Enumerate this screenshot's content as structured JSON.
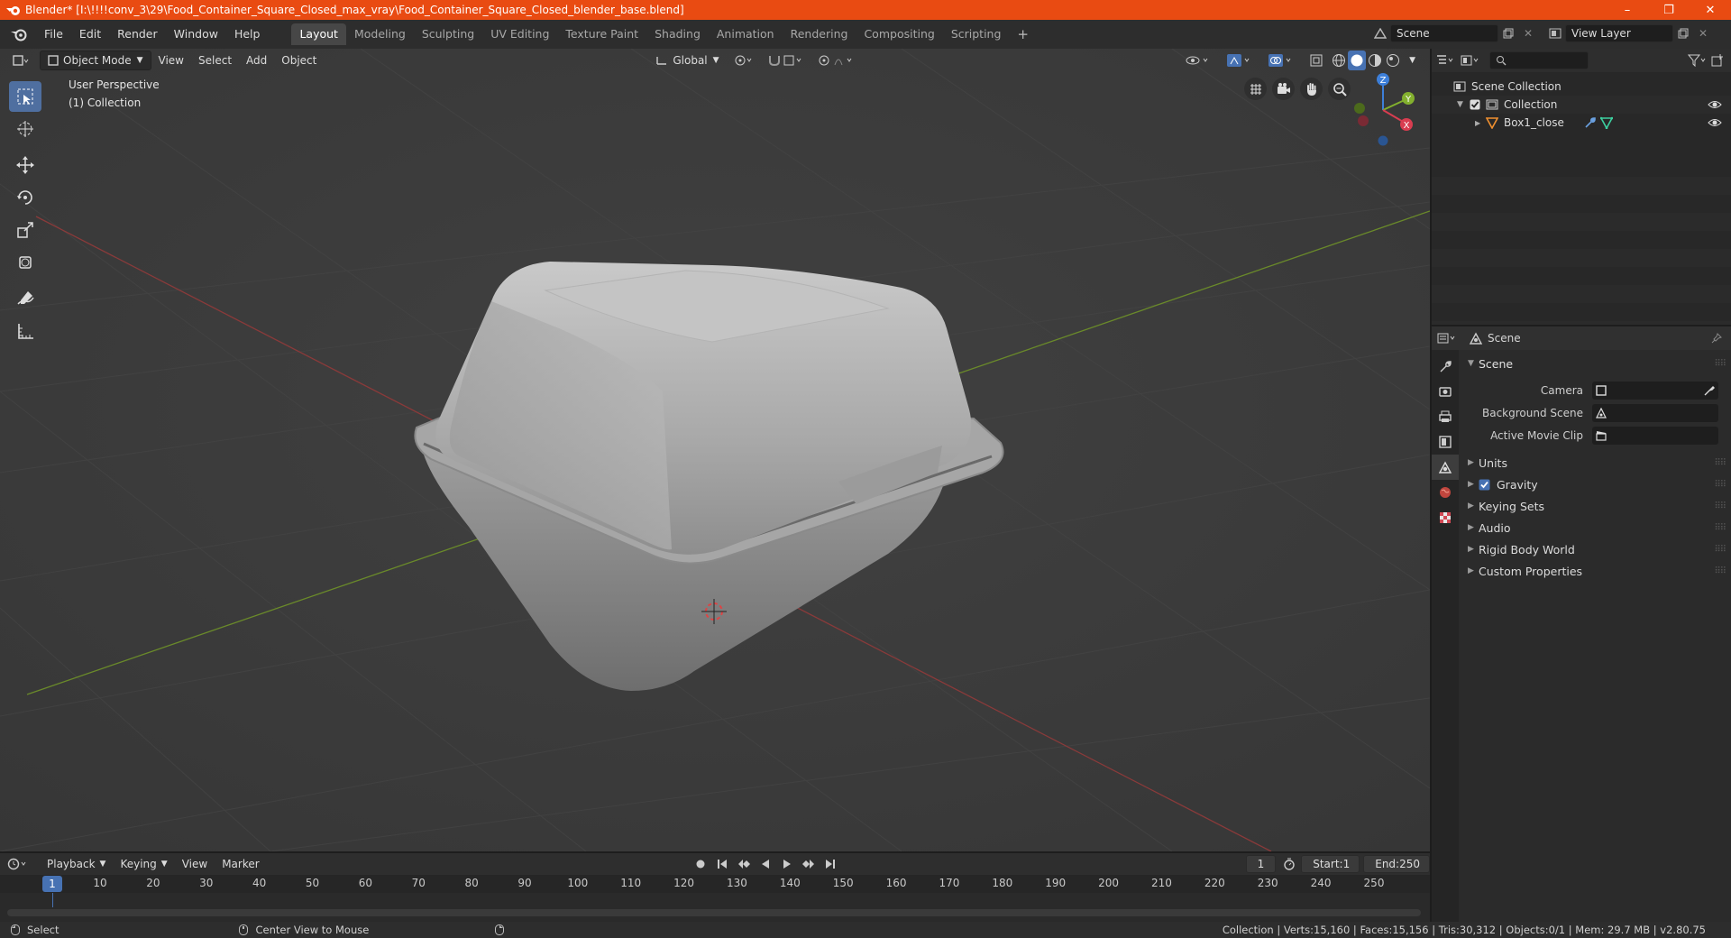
{
  "window": {
    "title": "Blender* [I:\\!!!!conv_3\\29\\Food_Container_Square_Closed_max_vray\\Food_Container_Square_Closed_blender_base.blend]",
    "minimize": "–",
    "maximize": "❐",
    "close": "✕"
  },
  "menu": {
    "items": [
      "File",
      "Edit",
      "Render",
      "Window",
      "Help"
    ]
  },
  "workspaces": {
    "tabs": [
      "Layout",
      "Modeling",
      "Sculpting",
      "UV Editing",
      "Texture Paint",
      "Shading",
      "Animation",
      "Rendering",
      "Compositing",
      "Scripting"
    ],
    "active": "Layout",
    "add": "+"
  },
  "scene_selector": {
    "scene": "Scene",
    "view_layer": "View Layer"
  },
  "viewport": {
    "mode": "Object Mode",
    "menus": [
      "View",
      "Select",
      "Add",
      "Object"
    ],
    "orientation": "Global",
    "perspective_label": "User Perspective",
    "collection_label": "(1) Collection",
    "gizmo": {
      "x": "X",
      "y": "Y",
      "z": "Z"
    },
    "grid_floor_color": "#3a3a3a",
    "x_axis_color": "#8a3a3a",
    "y_axis_color": "#6a8a2a",
    "tools": [
      "select-box-icon",
      "cursor-icon",
      "move-icon",
      "rotate-icon",
      "scale-icon",
      "transform-icon",
      "annotate-icon",
      "measure-icon"
    ]
  },
  "outliner": {
    "search_placeholder": "",
    "rows": [
      {
        "label": "Scene Collection"
      },
      {
        "label": "Collection"
      },
      {
        "label": "Box1_close"
      }
    ]
  },
  "properties": {
    "header": "Scene",
    "panel_title": "Scene",
    "fields": [
      {
        "label": "Camera",
        "value": ""
      },
      {
        "label": "Background Scene",
        "value": ""
      },
      {
        "label": "Active Movie Clip",
        "value": ""
      }
    ],
    "subpanels": [
      "Units",
      "Gravity",
      "Keying Sets",
      "Audio",
      "Rigid Body World",
      "Custom Properties"
    ],
    "gravity_checked": true
  },
  "timeline": {
    "menus": [
      "Playback",
      "Keying",
      "View",
      "Marker"
    ],
    "current_frame": "1",
    "start_label": "Start:",
    "start": "1",
    "end_label": "End:",
    "end": "250",
    "ticks": [
      "1",
      "10",
      "20",
      "30",
      "40",
      "50",
      "60",
      "70",
      "80",
      "90",
      "100",
      "110",
      "120",
      "130",
      "140",
      "150",
      "160",
      "170",
      "180",
      "190",
      "200",
      "210",
      "220",
      "230",
      "240",
      "250"
    ]
  },
  "statusbar": {
    "select": "Select",
    "center": "Center View to Mouse",
    "stats": "Collection | Verts:15,160 | Faces:15,156 | Tris:30,312 | Objects:0/1 | Mem: 29.7 MB | v2.80.75"
  }
}
